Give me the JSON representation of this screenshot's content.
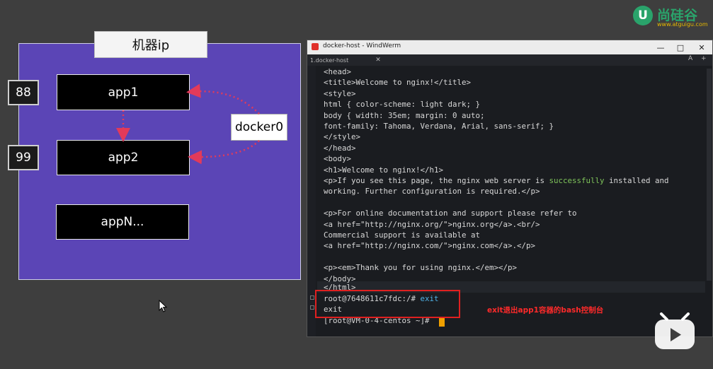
{
  "logo": {
    "mark": "U",
    "name": "尚硅谷",
    "url": "www.atguigu.com"
  },
  "diagram": {
    "title": "机器ip",
    "apps": [
      "app1",
      "app2",
      "appN..."
    ],
    "ports": [
      "88",
      "99"
    ],
    "bridge": "docker0"
  },
  "window": {
    "title": "docker-host - WindWerm",
    "controls": [
      "—",
      "□",
      "✕"
    ],
    "tab_label": "1.docker-host",
    "tab_close": "✕",
    "tab_right": [
      "A",
      "+"
    ]
  },
  "terminal": {
    "lines": [
      "<head>",
      "<title>Welcome to nginx!</title>",
      "<style>",
      "html { color-scheme: light dark; }",
      "body { width: 35em; margin: 0 auto;",
      "font-family: Tahoma, Verdana, Arial, sans-serif; }",
      "</style>",
      "</head>",
      "<body>",
      "<h1>Welcome to nginx!</h1>",
      "<p>If you see this page, the nginx web server is ",
      "working. Further configuration is required.</p>",
      "",
      "<p>For online documentation and support please refer to",
      "<a href=\"http://nginx.org/\">nginx.org</a>.<br/>",
      "Commercial support is available at",
      "<a href=\"http://nginx.com/\">nginx.com</a>.</p>",
      "",
      "<p><em>Thank you for using nginx.</em></p>",
      "</body>",
      "</html>"
    ],
    "ok_word": "successfully",
    "ok_rest": " installed and",
    "prompt1": "root@7648611c7fdc:/# ",
    "cmd1": "exit",
    "output1": "exit",
    "prompt2": "[root@VM-0-4-centos ~]# "
  },
  "annotation": "exit退出app1容器的bash控制台",
  "icons": {
    "pointer": "mouse-pointer-icon",
    "player": "bilibili-tv-icon"
  },
  "colors": {
    "host_box": "#5b45b6",
    "arrow": "#e23a5a",
    "highlight": "#e02020",
    "ok": "#7fc45a",
    "cmd": "#4fb3e8"
  }
}
